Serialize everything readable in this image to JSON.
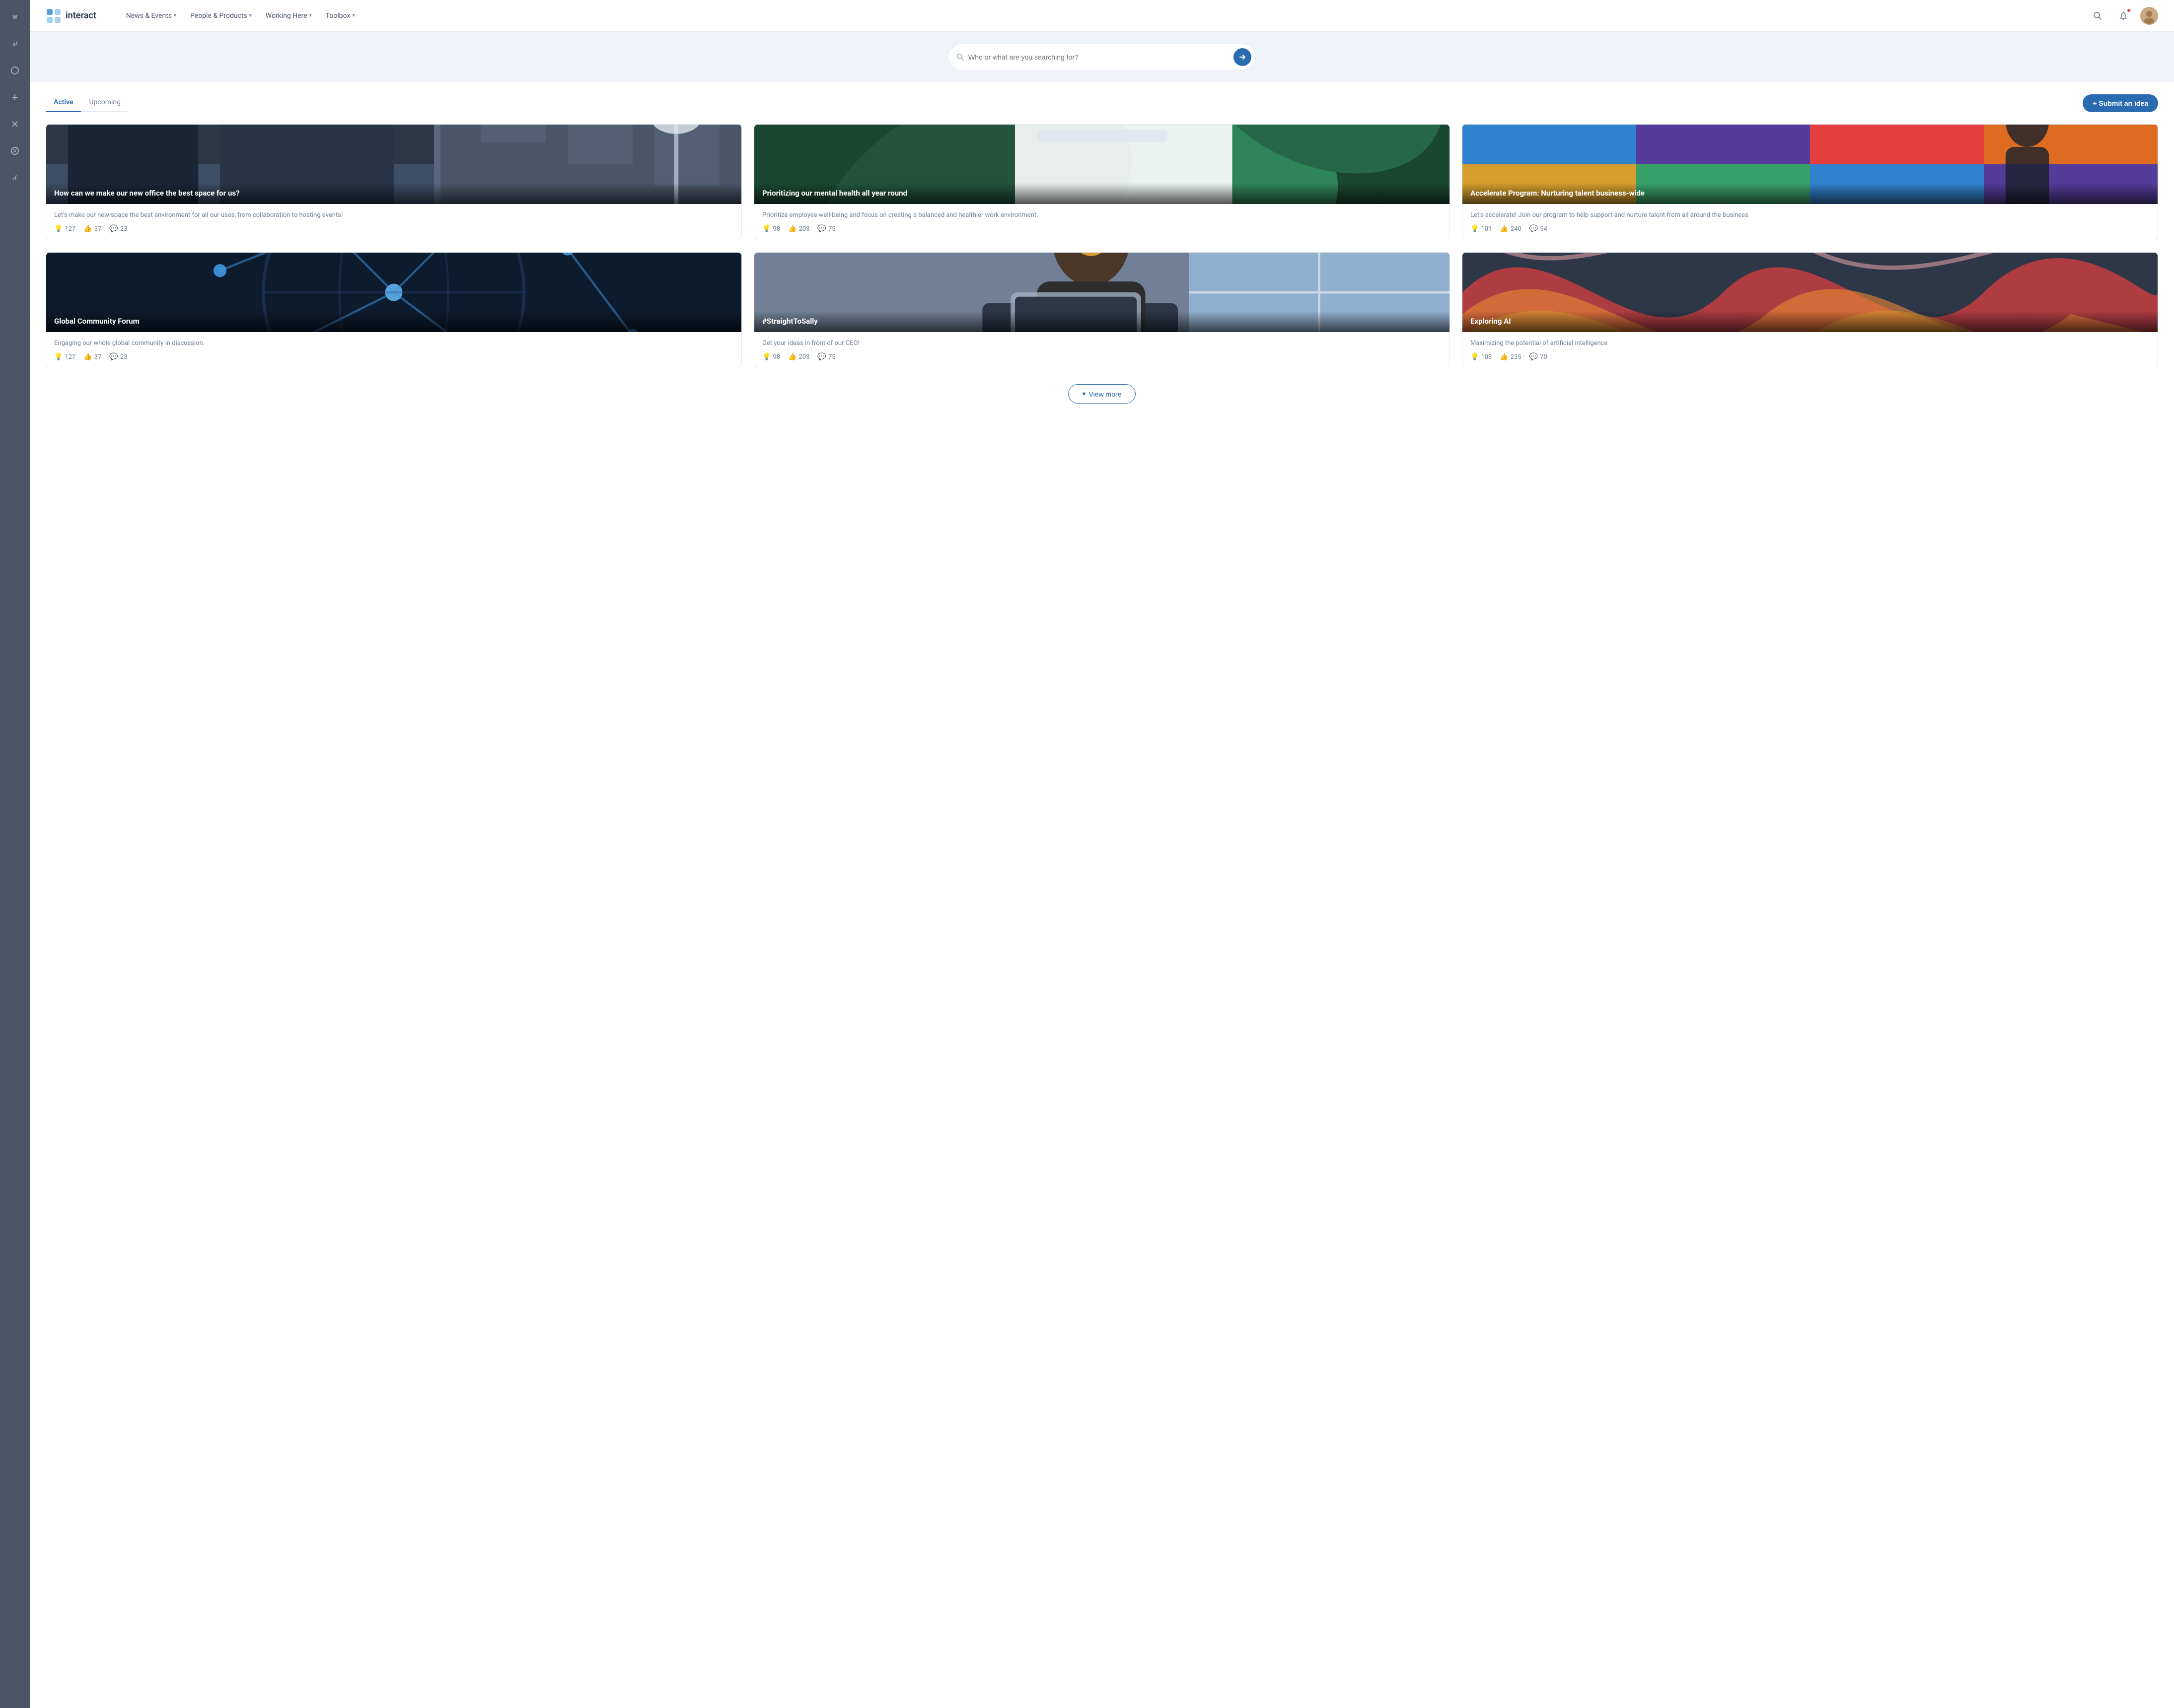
{
  "brand": {
    "logo_text": "interact",
    "logo_alt": "Interact logo"
  },
  "nav": {
    "items": [
      {
        "label": "News & Events",
        "has_dropdown": true
      },
      {
        "label": "People & Products",
        "has_dropdown": true
      },
      {
        "label": "Working Here",
        "has_dropdown": true
      },
      {
        "label": "Toolbox",
        "has_dropdown": true
      }
    ]
  },
  "search": {
    "placeholder": "Who or what are you searching for?",
    "button_label": "→"
  },
  "tabs": [
    {
      "label": "Active",
      "active": true
    },
    {
      "label": "Upcoming",
      "active": false
    }
  ],
  "submit_idea_button": "+ Submit an idea",
  "cards": [
    {
      "id": "card-1",
      "title": "How can we make our new office the best space for us?",
      "description": "Let's make our new space the best environment for all our uses, from collaboration to hosting events!",
      "stats": {
        "views": 127,
        "likes": 37,
        "comments": 23
      },
      "bg_class": "card-bg-1"
    },
    {
      "id": "card-2",
      "title": "Prioritizing our mental health all year round",
      "description": "Prioritize employee well-being and focus on creating a balanced and healthier work environment.",
      "stats": {
        "views": 98,
        "likes": 203,
        "comments": 75
      },
      "bg_class": "card-bg-2"
    },
    {
      "id": "card-3",
      "title": "Accelerate Program: Nurturing talent business-wide",
      "description": "Let's accelerate! Join our program to help support and nurture talent from all around the business",
      "stats": {
        "views": 101,
        "likes": 240,
        "comments": 54
      },
      "bg_class": "card-bg-3"
    },
    {
      "id": "card-4",
      "title": "Global Community Forum",
      "description": "Engaging our whole global community in discussion.",
      "stats": {
        "views": 127,
        "likes": 37,
        "comments": 23
      },
      "bg_class": "card-bg-4"
    },
    {
      "id": "card-5",
      "title": "#StraightToSally",
      "description": "Get your ideas in front of our CEO!",
      "stats": {
        "views": 98,
        "likes": 203,
        "comments": 75
      },
      "bg_class": "card-bg-5"
    },
    {
      "id": "card-6",
      "title": "Exploring AI",
      "description": "Maximizing the potential of artificial intelligence",
      "stats": {
        "views": 103,
        "likes": 235,
        "comments": 70
      },
      "bg_class": "card-bg-6"
    }
  ],
  "view_more_button": "View more",
  "sidebar_icons": [
    "W",
    "sf",
    "○",
    "+",
    "✕",
    "⊗",
    "if"
  ]
}
